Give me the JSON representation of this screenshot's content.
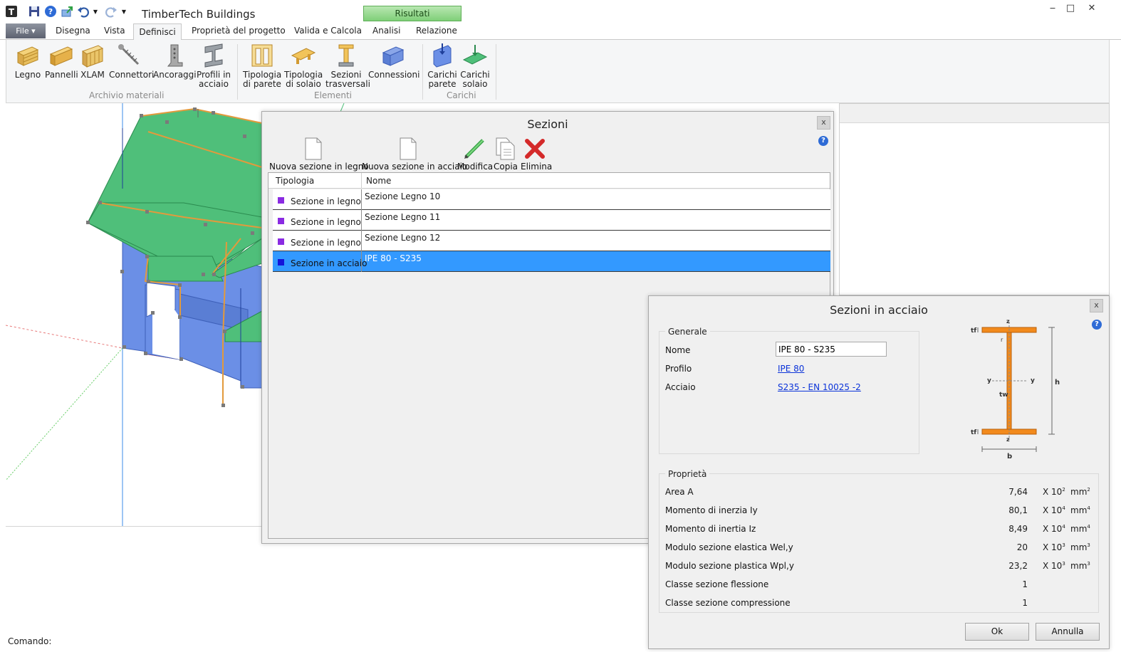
{
  "app": {
    "title": "TimberTech Buildings",
    "results_tab": "Risultati"
  },
  "quick_access": [
    "app-logo-icon",
    "save-icon",
    "help-icon",
    "export-icon",
    "undo-icon",
    "redo-icon"
  ],
  "window_controls": {
    "minimize": "‒",
    "maximize": "□",
    "close": "✕"
  },
  "ribbon": {
    "file_label": "File",
    "tabs": [
      "Disegna",
      "Vista",
      "Definisci",
      "Proprietà del progetto",
      "Valida e Calcola",
      "Analisi",
      "Relazione"
    ],
    "groups": {
      "archivio": "Archivio materiali",
      "elementi": "Elementi",
      "carichi": "Carichi"
    },
    "buttons": {
      "legno": "Legno",
      "pannelli": "Pannelli",
      "xlam": "XLAM",
      "connettori": "Connettori",
      "ancoraggi": "Ancoraggi",
      "profili_1": "Profili in",
      "profili_2": "acciaio",
      "tip_parete_1": "Tipologia",
      "tip_parete_2": "di parete",
      "tip_solaio_1": "Tipologia",
      "tip_solaio_2": "di solaio",
      "sezioni_1": "Sezioni",
      "sezioni_2": "trasversali",
      "connessioni": "Connessioni",
      "carichi_parete_1": "Carichi",
      "carichi_parete_2": "parete",
      "carichi_solaio_1": "Carichi",
      "carichi_solaio_2": "solaio"
    }
  },
  "command": {
    "label": "Comando:"
  },
  "sezioni_dialog": {
    "title": "Sezioni",
    "close": "x",
    "help": "?",
    "toolbar": {
      "new_wood": "Nuova sezione in legno",
      "new_steel": "Nuova sezione in acciaio",
      "edit": "Modifica",
      "copy": "Copia",
      "delete": "Elimina"
    },
    "columns": {
      "type": "Tipologia",
      "name": "Nome"
    },
    "rows": [
      {
        "type": "Sezione in legno",
        "name": "Sezione Legno 10",
        "color": "#8a2be2"
      },
      {
        "type": "Sezione in legno",
        "name": "Sezione Legno 11",
        "color": "#8a2be2"
      },
      {
        "type": "Sezione in legno",
        "name": "Sezione Legno 12",
        "color": "#8a2be2"
      },
      {
        "type": "Sezione in acciaio",
        "name": "IPE 80 - S235",
        "color": "#1414d9",
        "selected": true
      }
    ]
  },
  "acciaio_dialog": {
    "title": "Sezioni in acciaio",
    "close": "x",
    "help": "?",
    "generale": {
      "legend": "Generale",
      "nome_label": "Nome",
      "nome_value": "IPE 80 - S235",
      "profilo_label": "Profilo",
      "profilo_value": "IPE 80",
      "acciaio_label": "Acciaio",
      "acciaio_value": "S235 - EN 10025 -2"
    },
    "diagram": {
      "tf": "tf",
      "r": "r",
      "y": "y",
      "tw": "tw",
      "h": "h",
      "b": "b",
      "z": "z"
    },
    "proprieta": {
      "legend": "Proprietà",
      "rows": [
        {
          "label": "Area A",
          "value": "7,64",
          "exp": "2",
          "unit": "mm",
          "unit_exp": "2"
        },
        {
          "label": "Momento di inerzia Iy",
          "value": "80,1",
          "exp": "4",
          "unit": "mm",
          "unit_exp": "4"
        },
        {
          "label": "Momento di inertia Iz",
          "value": "8,49",
          "exp": "4",
          "unit": "mm",
          "unit_exp": "4"
        },
        {
          "label": "Modulo sezione elastica Wel,y",
          "value": "20",
          "exp": "3",
          "unit": "mm",
          "unit_exp": "3"
        },
        {
          "label": "Modulo sezione plastica Wpl,y",
          "value": "23,2",
          "exp": "3",
          "unit": "mm",
          "unit_exp": "3"
        },
        {
          "label": "Classe sezione flessione",
          "value": "1"
        },
        {
          "label": "Classe sezione compressione",
          "value": "1"
        }
      ],
      "exp_prefix": "X 10"
    },
    "buttons": {
      "ok": "Ok",
      "cancel": "Annulla"
    }
  },
  "colors": {
    "roof_green": "#4fbf7a",
    "wall_blue": "#6b8fe6",
    "beam_orange": "#e39a3c",
    "selection": "#3399ff",
    "steel_orange": "#f28a1c"
  }
}
